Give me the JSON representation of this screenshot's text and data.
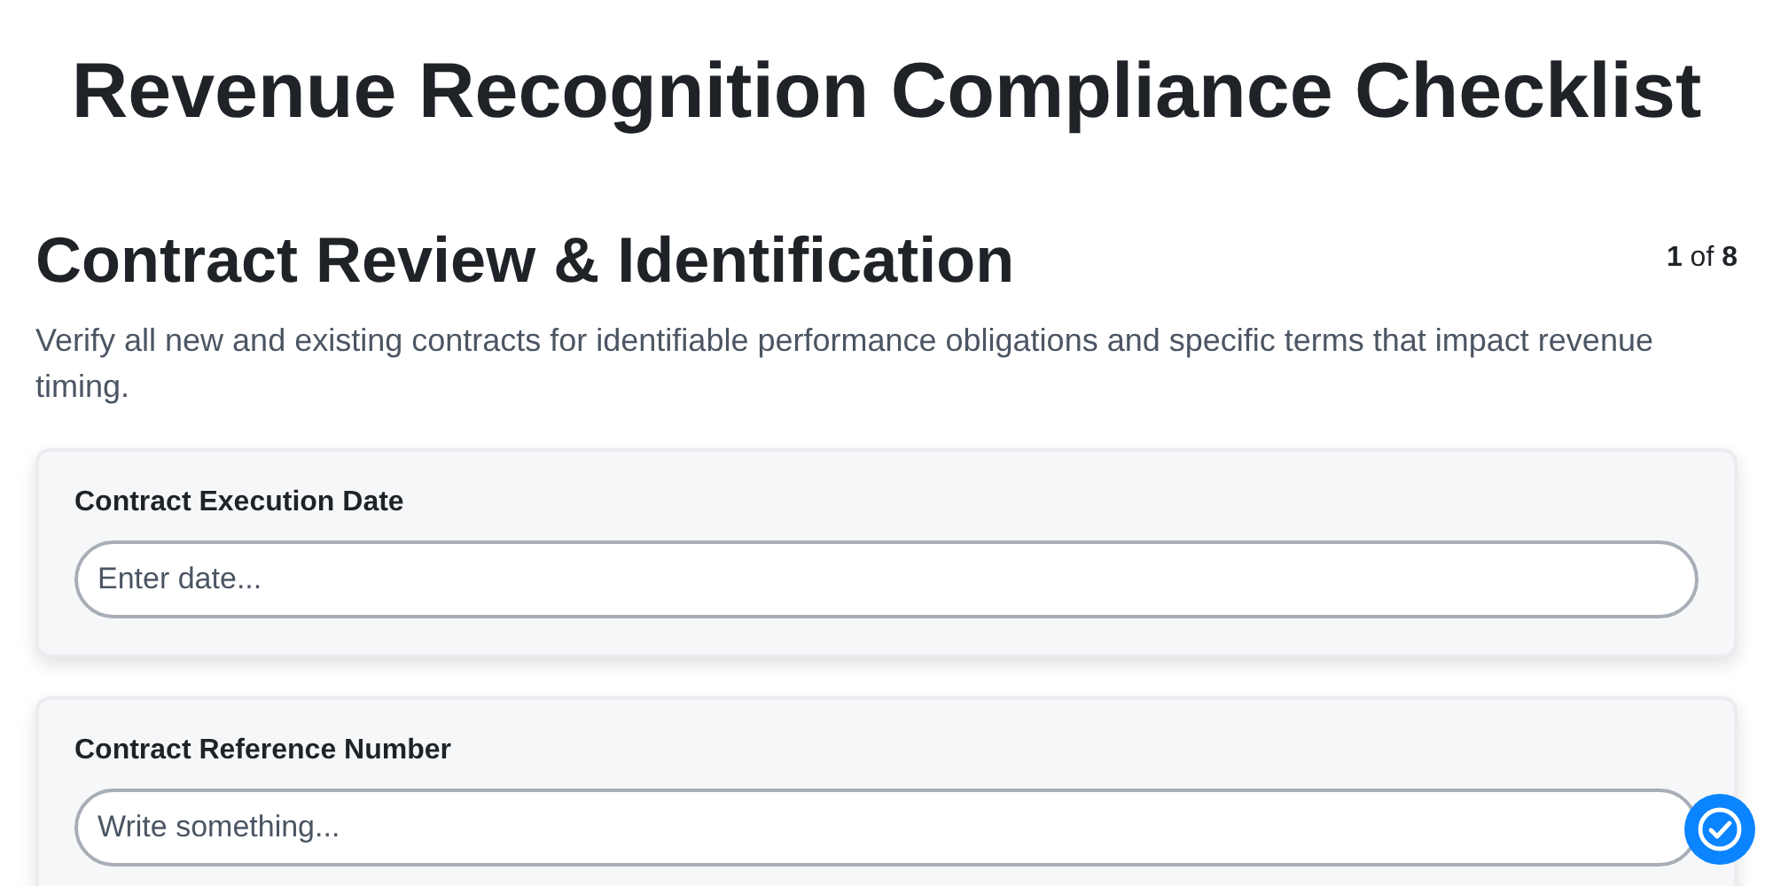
{
  "title": "Revenue Recognition Compliance Checklist",
  "section": {
    "heading": "Contract Review & Identification",
    "progress": "**1** of **8**",
    "description": "Verify all new and existing contracts for identifiable performance obligations and specific terms that impact revenue timing."
  },
  "fields": [
    {
      "label": "Contract Execution Date",
      "placeholder": "Enter date..."
    },
    {
      "label": "Contract Reference Number",
      "placeholder": "Write something..."
    }
  ]
}
